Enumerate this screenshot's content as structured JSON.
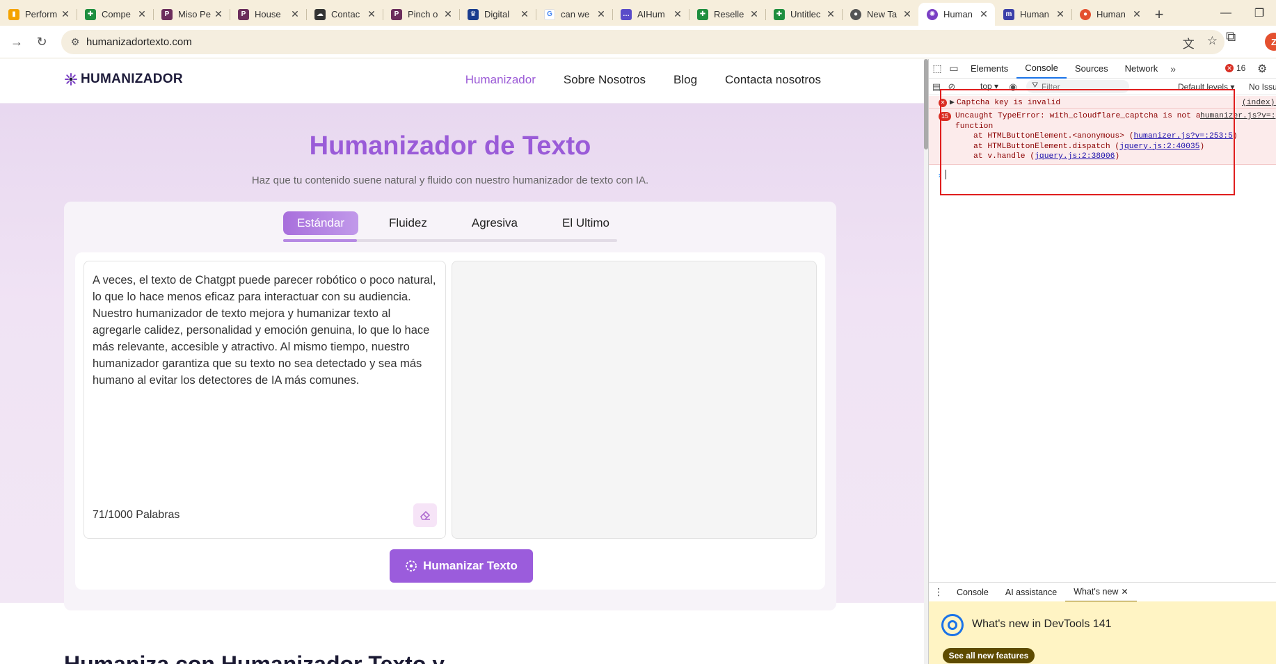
{
  "browser": {
    "tabs": [
      {
        "title": "Perform",
        "icon": "analytics-icon",
        "color": "#f4a300"
      },
      {
        "title": "Compe",
        "icon": "sheets-icon",
        "color": "#1e8e3e"
      },
      {
        "title": "Miso Pe",
        "icon": "p-icon",
        "color": "#6b2d5c"
      },
      {
        "title": "House",
        "icon": "p-icon",
        "color": "#6b2d5c"
      },
      {
        "title": "Contac",
        "icon": "chat-icon",
        "color": "#333333"
      },
      {
        "title": "Pinch o",
        "icon": "p-icon",
        "color": "#6b2d5c"
      },
      {
        "title": "Digital",
        "icon": "crown-icon",
        "color": "#1a3c8e"
      },
      {
        "title": "can we",
        "icon": "google-icon",
        "color": "#4285f4"
      },
      {
        "title": "AIHum",
        "icon": "chat-bubble-icon",
        "color": "#5a4bc9"
      },
      {
        "title": "Reselle",
        "icon": "sheets-icon",
        "color": "#1e8e3e"
      },
      {
        "title": "Untitlec",
        "icon": "sheets-icon",
        "color": "#1e8e3e"
      },
      {
        "title": "New Ta",
        "icon": "chrome-icon",
        "color": "#555555"
      },
      {
        "title": "Human",
        "icon": "humanizador-icon",
        "color": "#7a3fc4",
        "active": true
      },
      {
        "title": "Human",
        "icon": "m-icon",
        "color": "#3b3fa8"
      },
      {
        "title": "Human",
        "icon": "tomato-icon",
        "color": "#e4502f"
      }
    ],
    "url": "humanizadortexto.com",
    "profile_initial": "Z"
  },
  "site": {
    "logo_text": "HUMANIZADOR",
    "nav": [
      "Humanizador",
      "Sobre Nosotros",
      "Blog",
      "Contacta nosotros"
    ],
    "hero_title": "Humanizador de Texto",
    "hero_subtitle": "Haz que tu contenido suene natural y fluido con nuestro humanizador de texto con IA.",
    "modes": [
      "Estándar",
      "Fluidez",
      "Agresiva",
      "El Ultimo"
    ],
    "input_text": "A veces, el texto de Chatgpt puede parecer robótico o poco natural, lo que lo hace menos eficaz para interactuar con su audiencia. Nuestro humanizador de texto mejora y humanizar texto al agregarle calidez, personalidad y emoción genuina, lo que lo hace más relevante, accesible y atractivo. Al mismo tiempo, nuestro humanizador garantiza que su texto no sea detectado y sea más humano al evitar los detectores de IA más comunes.",
    "word_count": "71/1000 Palabras",
    "submit_label": "Humanizar Texto",
    "below_heading": "Humaniza con Humanizador Texto y"
  },
  "devtools": {
    "tabs": [
      "Elements",
      "Console",
      "Sources",
      "Network"
    ],
    "error_count": "16",
    "context": "top ▾",
    "filter_placeholder": "Filter",
    "levels": "Default levels ▾",
    "issues": "No Issues",
    "messages": [
      {
        "text": "Captcha key is invalid",
        "source": "(index):"
      },
      {
        "count": "15",
        "text": "Uncaught TypeError: with_cloudflare_captcha is not a",
        "text_cont": "function",
        "source": "humanizer.js?v=:",
        "stack": [
          {
            "prefix": "at HTMLButtonElement.<anonymous> (",
            "link": "humanizer.js?v=:253:5",
            "suffix": ")"
          },
          {
            "prefix": "at HTMLButtonElement.dispatch (",
            "link": "jquery.js:2:40035",
            "suffix": ")"
          },
          {
            "prefix": "at v.handle (",
            "link": "jquery.js:2:38006",
            "suffix": ")"
          }
        ]
      }
    ],
    "drawer_tabs": [
      "Console",
      "AI assistance",
      "What's new"
    ],
    "whats_new_title": "What's new in DevTools 141",
    "whats_new_button": "See all new features",
    "colors": {
      "accent": "#9b5cdc",
      "error": "#d93025",
      "highlight": "#e01e1e"
    }
  }
}
